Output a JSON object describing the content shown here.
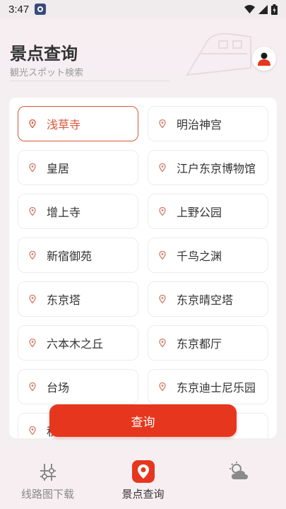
{
  "status_bar": {
    "time": "3:47"
  },
  "header": {
    "title": "景点查询",
    "subtitle": "観光スポット検索"
  },
  "spots": [
    {
      "label": "浅草寺",
      "selected": true
    },
    {
      "label": "明治神宫",
      "selected": false
    },
    {
      "label": "皇居",
      "selected": false
    },
    {
      "label": "江户东京博物馆",
      "selected": false
    },
    {
      "label": "增上寺",
      "selected": false
    },
    {
      "label": "上野公园",
      "selected": false
    },
    {
      "label": "新宿御苑",
      "selected": false
    },
    {
      "label": "千鸟之渊",
      "selected": false
    },
    {
      "label": "东京塔",
      "selected": false
    },
    {
      "label": "东京晴空塔",
      "selected": false
    },
    {
      "label": "六本木之丘",
      "selected": false
    },
    {
      "label": "东京都厅",
      "selected": false
    },
    {
      "label": "台场",
      "selected": false
    },
    {
      "label": "东京迪士尼乐园",
      "selected": false
    },
    {
      "label": "秋",
      "selected": false
    },
    {
      "label": "",
      "selected": false
    }
  ],
  "query_button": {
    "label": "查询"
  },
  "tabs": [
    {
      "label": "线路图下载",
      "icon": "route-map-icon",
      "active": false
    },
    {
      "label": "景点查询",
      "icon": "location-pin-icon",
      "active": true
    },
    {
      "label": "",
      "icon": "weather-icon",
      "active": false
    }
  ],
  "colors": {
    "accent": "#e6371e",
    "selected_border": "#d9573a"
  }
}
